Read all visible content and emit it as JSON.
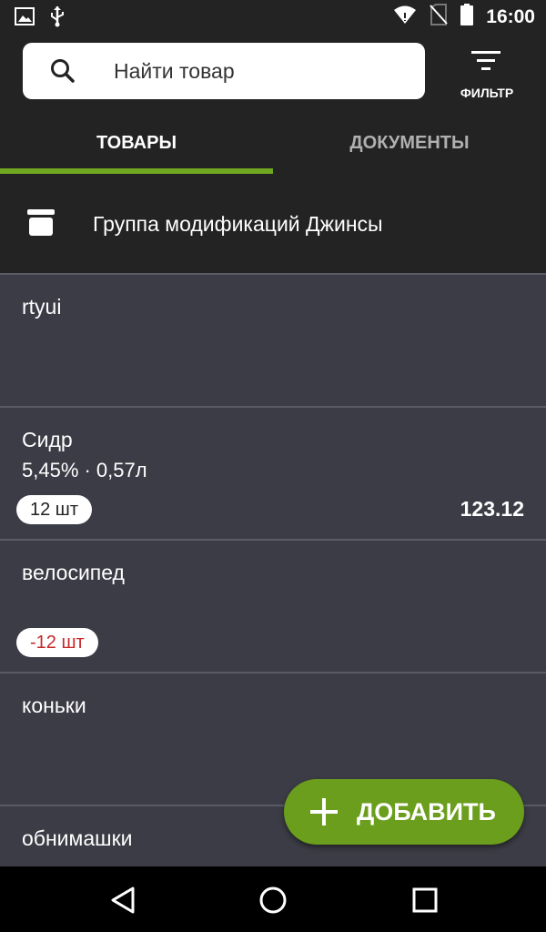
{
  "status_bar": {
    "time": "16:00",
    "left_icons": [
      "image-icon",
      "usb-icon"
    ],
    "right_icons": [
      "wifi-icon",
      "no-sim-icon",
      "battery-icon"
    ]
  },
  "header": {
    "search": {
      "placeholder": "Найти товар",
      "icon": "search-icon"
    },
    "filter": {
      "label": "ФИЛЬТР",
      "icon": "filter-icon"
    }
  },
  "tabs": [
    {
      "label": "ТОВАРЫ",
      "active": true
    },
    {
      "label": "ДОКУМЕНТЫ",
      "active": false
    }
  ],
  "group": {
    "label": "Группа модификаций Джинсы",
    "icon": "archive-icon"
  },
  "items": [
    {
      "name": "rtyui"
    },
    {
      "name": "Сидр",
      "details": "5,45% · 0,57л",
      "quantity": "12 шт",
      "price": "123.12"
    },
    {
      "name": "велосипед",
      "quantity": "-12 шт"
    },
    {
      "name": "коньки"
    },
    {
      "name": "обнимашки"
    }
  ],
  "fab": {
    "label": "ДОБАВИТЬ",
    "icon": "plus-icon"
  },
  "nav": {
    "icons": [
      "back-icon",
      "home-icon",
      "recents-icon"
    ]
  },
  "colors": {
    "accent": "#6fa81e",
    "fab": "#6a9e1c",
    "list_background": "#3c3c46",
    "header_background": "#232323",
    "negative_quantity": "#c62828"
  }
}
